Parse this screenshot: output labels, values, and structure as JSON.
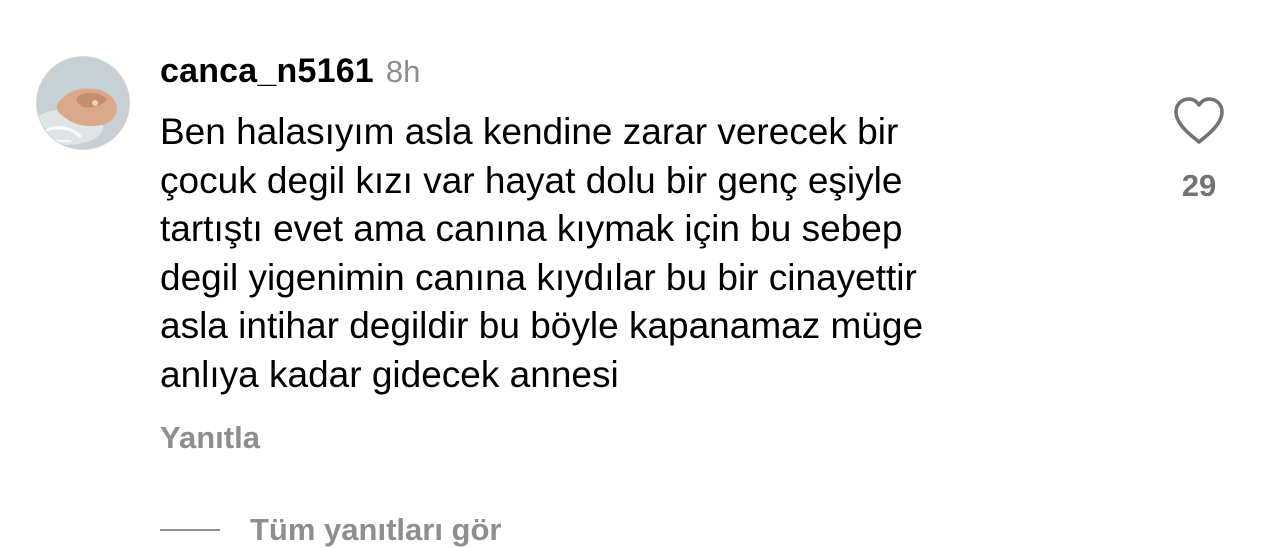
{
  "comment": {
    "username": "canca_n5161",
    "timestamp": "8h",
    "body_lines": [
      "Ben halasıyım asla kendine zarar verecek bir",
      "çocuk degil kızı var hayat dolu bir genç eşiyle",
      "tartıştı evet ama canına kıymak için bu sebep",
      "degil yigenimin canına kıydılar bu bir cinayettir",
      "asla intihar degildir bu böyle kapanamaz müge",
      "anlıya kadar gidecek annesi"
    ],
    "reply_label": "Yanıtla",
    "like_count": "29",
    "like_icon": "heart-outline-icon",
    "avatar_icon": "user-avatar-photo",
    "view_replies_label": "Tüm yanıtları gör"
  },
  "colors": {
    "primary_text": "#000000",
    "secondary_text": "#8e8e8e",
    "like_count": "#737373",
    "background": "#ffffff"
  }
}
